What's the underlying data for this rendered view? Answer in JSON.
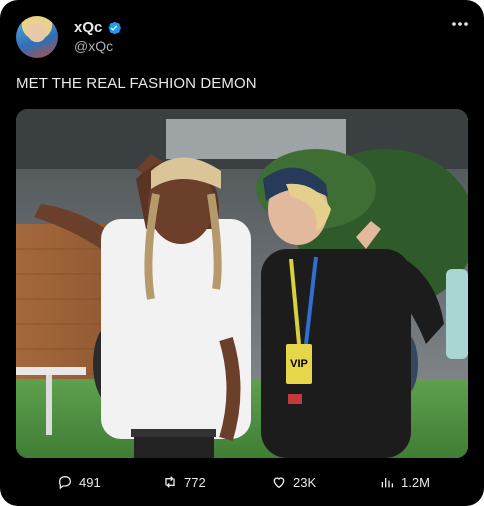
{
  "author": {
    "name": "xQc",
    "handle": "@xQc",
    "verified": true
  },
  "tweet": {
    "text": "MET THE REAL FASHION DEMON",
    "media": {
      "badge_text": "VIP"
    }
  },
  "metrics": {
    "replies": "491",
    "reposts": "772",
    "likes": "23K",
    "views": "1.2M"
  },
  "icons": {
    "more": "more-horizontal-icon",
    "verified": "verified-badge-icon",
    "reply": "reply-icon",
    "repost": "repost-icon",
    "like": "heart-icon",
    "views": "views-chart-icon"
  },
  "colors": {
    "background": "#000000",
    "text": "#e7e9ea",
    "secondary": "#a9b0b6",
    "verified": "#1d9bf0"
  }
}
